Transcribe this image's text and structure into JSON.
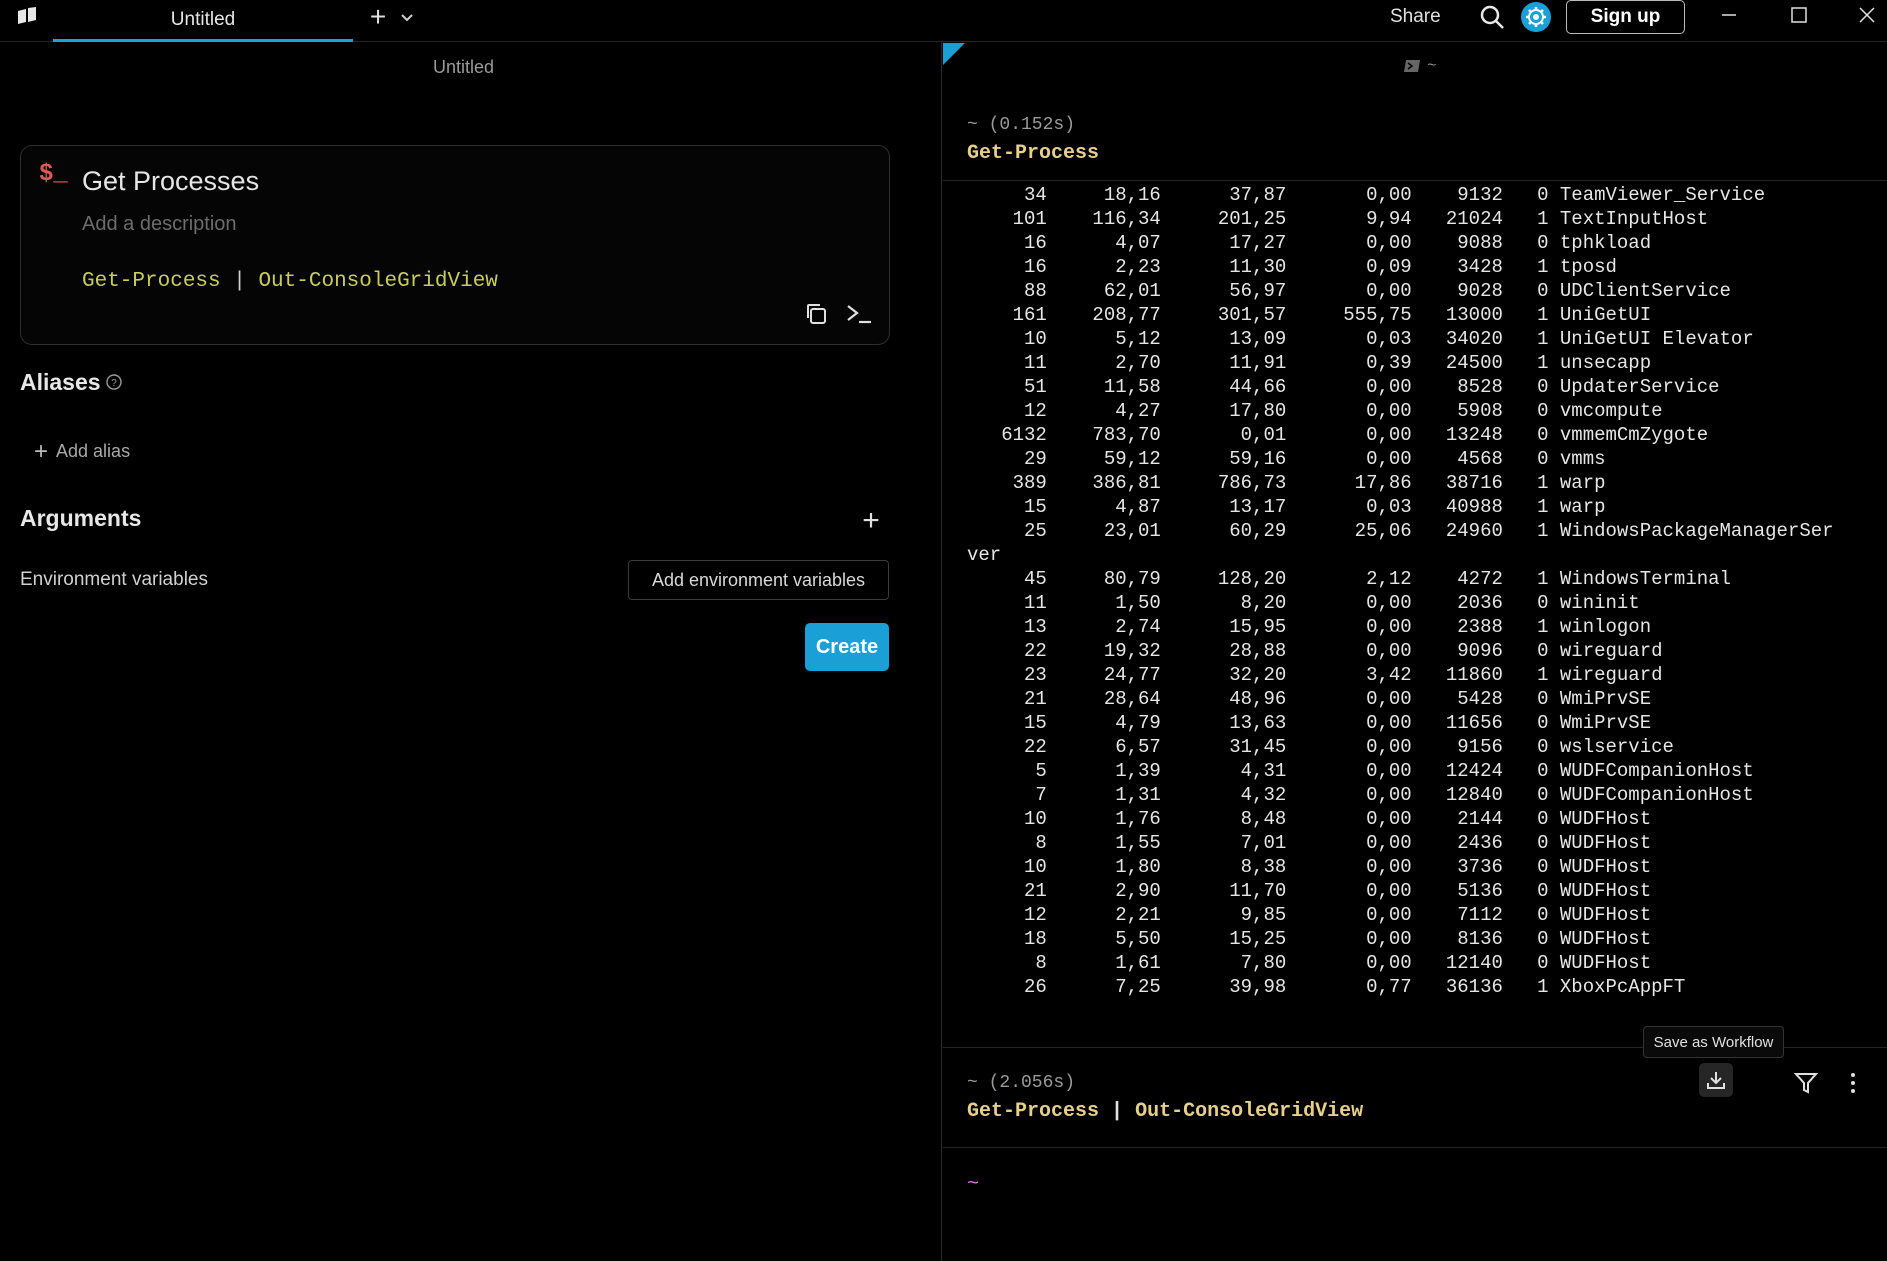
{
  "titlebar": {
    "tab_label": "Untitled",
    "share_label": "Share",
    "signup_label": "Sign up"
  },
  "workflow_editor": {
    "pane_title": "Untitled",
    "name": "Get Processes",
    "description_placeholder": "Add a description",
    "command_part1": "Get-Process",
    "command_pipe": "|",
    "command_part2": "Out-ConsoleGridView",
    "aliases_title": "Aliases",
    "add_alias_label": "Add alias",
    "arguments_title": "Arguments",
    "env_label": "Environment variables",
    "env_button": "Add environment variables",
    "create_button": "Create"
  },
  "terminal": {
    "header": "~",
    "block1": {
      "meta": "~ (0.152s)",
      "command": "Get-Process"
    },
    "output_lines": [
      "     34     18,16      37,87       0,00    9132   0 TeamViewer_Service",
      "    101    116,34     201,25       9,94   21024   1 TextInputHost",
      "     16      4,07      17,27       0,00    9088   0 tphkload",
      "     16      2,23      11,30       0,09    3428   1 tposd",
      "     88     62,01      56,97       0,00    9028   0 UDClientService",
      "    161    208,77     301,57     555,75   13000   1 UniGetUI",
      "     10      5,12      13,09       0,03   34020   1 UniGetUI Elevator",
      "     11      2,70      11,91       0,39   24500   1 unsecapp",
      "     51     11,58      44,66       0,00    8528   0 UpdaterService",
      "     12      4,27      17,80       0,00    5908   0 vmcompute",
      "   6132    783,70       0,01       0,00   13248   0 vmmemCmZygote",
      "     29     59,12      59,16       0,00    4568   0 vmms",
      "    389    386,81     786,73      17,86   38716   1 warp",
      "     15      4,87      13,17       0,03   40988   1 warp",
      "     25     23,01      60,29      25,06   24960   1 WindowsPackageManagerSer",
      "ver",
      "     45     80,79     128,20       2,12    4272   1 WindowsTerminal",
      "     11      1,50       8,20       0,00    2036   0 wininit",
      "     13      2,74      15,95       0,00    2388   1 winlogon",
      "     22     19,32      28,88       0,00    9096   0 wireguard",
      "     23     24,77      32,20       3,42   11860   1 wireguard",
      "     21     28,64      48,96       0,00    5428   0 WmiPrvSE",
      "     15      4,79      13,63       0,00   11656   0 WmiPrvSE",
      "     22      6,57      31,45       0,00    9156   0 wslservice",
      "      5      1,39       4,31       0,00   12424   0 WUDFCompanionHost",
      "      7      1,31       4,32       0,00   12840   0 WUDFCompanionHost",
      "     10      1,76       8,48       0,00    2144   0 WUDFHost",
      "      8      1,55       7,01       0,00    2436   0 WUDFHost",
      "     10      1,80       8,38       0,00    3736   0 WUDFHost",
      "     21      2,90      11,70       0,00    5136   0 WUDFHost",
      "     12      2,21       9,85       0,00    7112   0 WUDFHost",
      "     18      5,50      15,25       0,00    8136   0 WUDFHost",
      "      8      1,61       7,80       0,00   12140   0 WUDFHost",
      "     26      7,25      39,98       0,77   36136   1 XboxPcAppFT"
    ],
    "tooltip": "Save as Workflow",
    "block2": {
      "meta": "~ (2.056s)",
      "command_part1": "Get-Process",
      "command_pipe": "|",
      "command_part2": "Out-ConsoleGridView"
    },
    "prompt": "~"
  },
  "colors": {
    "accent": "#1aa0d6",
    "command_green": "#c9cc5c",
    "command_yellow": "#e6cf8a",
    "prompt_pink": "#d67ad6",
    "dollar_red": "#e05a52"
  },
  "icons": [
    "app-icon",
    "plus-icon",
    "chevron-down-icon",
    "search-icon",
    "gear-icon",
    "minimize-icon",
    "maximize-icon",
    "close-icon",
    "copy-icon",
    "terminal-icon",
    "help-icon",
    "save-icon",
    "filter-icon",
    "kebab-icon"
  ]
}
